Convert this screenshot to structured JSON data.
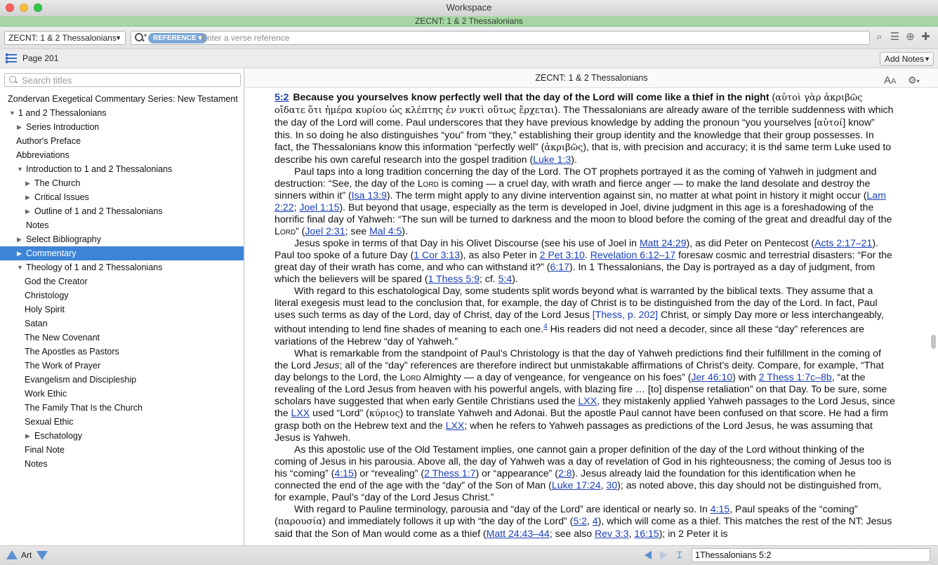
{
  "window": {
    "title": "Workspace",
    "subtitle": "ZECNT: 1 & 2 Thessalonians"
  },
  "toolbar": {
    "book_select": "ZECNT: 1 & 2 Thessalonians",
    "reference_pill": "REFERENCE",
    "reference_placeholder": "Enter a verse reference",
    "icons": [
      "search-icon",
      "list-icon",
      "add-icon",
      "puzzle-icon"
    ]
  },
  "row2": {
    "page_label": "Page 201",
    "add_notes": "Add Notes"
  },
  "sidebar": {
    "search_placeholder": "Search titles",
    "tree": [
      {
        "label": "Zondervan Exegetical Commentary Series: New Testament",
        "level": 0,
        "tri": ""
      },
      {
        "label": "1 and 2 Thessalonians",
        "level": 1,
        "tri": "▼"
      },
      {
        "label": "Series Introduction",
        "level": 2,
        "tri": "▶"
      },
      {
        "label": "Author's Preface",
        "level": 1,
        "tri": ""
      },
      {
        "label": "Abbreviations",
        "level": 1,
        "tri": ""
      },
      {
        "label": "Introduction to 1 and 2 Thessalonians",
        "level": 2,
        "tri": "▼"
      },
      {
        "label": "The Church",
        "level": 3,
        "tri": "▶"
      },
      {
        "label": "Critical Issues",
        "level": 3,
        "tri": "▶"
      },
      {
        "label": "Outline of 1 and 2 Thessalonians",
        "level": 3,
        "tri": "▶"
      },
      {
        "label": "Notes",
        "level": 2,
        "tri": ""
      },
      {
        "label": "Select Bibliography",
        "level": 2,
        "tri": "▶"
      },
      {
        "label": "Commentary",
        "level": 2,
        "tri": "▶",
        "selected": true
      },
      {
        "label": "Theology of 1 and 2 Thessalonians",
        "level": 2,
        "tri": "▼"
      },
      {
        "label": "God the Creator",
        "level": 3,
        "tri": ""
      },
      {
        "label": "Christology",
        "level": 3,
        "tri": ""
      },
      {
        "label": "Holy Spirit",
        "level": 3,
        "tri": ""
      },
      {
        "label": "Satan",
        "level": 3,
        "tri": ""
      },
      {
        "label": "The New Covenant",
        "level": 3,
        "tri": ""
      },
      {
        "label": "The Apostles as Pastors",
        "level": 3,
        "tri": ""
      },
      {
        "label": "The Work of Prayer",
        "level": 3,
        "tri": ""
      },
      {
        "label": "Evangelism and Discipleship",
        "level": 3,
        "tri": ""
      },
      {
        "label": "Work Ethic",
        "level": 3,
        "tri": ""
      },
      {
        "label": "The Family That Is the Church",
        "level": 3,
        "tri": ""
      },
      {
        "label": "Sexual Ethic",
        "level": 3,
        "tri": ""
      },
      {
        "label": "Eschatology",
        "level": 3,
        "tri": "▶"
      },
      {
        "label": "Final Note",
        "level": 3,
        "tri": ""
      },
      {
        "label": "Notes",
        "level": 3,
        "tri": ""
      }
    ]
  },
  "content": {
    "header": "ZECNT: 1 & 2 Thessalonians",
    "aa_icon": "text-size-icon",
    "gear_icon": "gear-icon",
    "paragraphs": [
      [
        {
          "t": "vn",
          "s": "5:2"
        },
        {
          "t": "b",
          "s": "Because you yourselves know perfectly well that the day of the Lord will come like a thief in the night"
        },
        {
          "t": "x",
          "s": " ("
        },
        {
          "t": "g",
          "s": "αὐτοὶ γὰρ ἀκριβῶς οἴδατε ὅτι ἡμέρα κυρίου ὡς κλέπτης ἐν νυκτὶ οὕτως ἔρχεται"
        },
        {
          "t": "x",
          "s": "). The Thessalonians are already aware of the terrible suddenness with which the day of the Lord will come. Paul underscores that they have previous knowledge by adding the pronoun “you yourselves ["
        },
        {
          "t": "g",
          "s": "αὐτοί"
        },
        {
          "t": "x",
          "s": "] know” this. In so doing he also distinguishes “you” from “they,” establishing their group identity and the knowledge that their group possesses. In fact, the Thessalonians know this information “perfectly well” ("
        },
        {
          "t": "g",
          "s": "ἀκριβῶς"
        },
        {
          "t": "x",
          "s": "), that is, with precision and accuracy; it is the same term Luke used to describe his own careful research into the gospel tradition ("
        },
        {
          "t": "l",
          "s": "Luke 1:3"
        },
        {
          "t": "x",
          "s": ")."
        }
      ],
      [
        {
          "t": "x",
          "s": "Paul taps into a long tradition concerning the day of the Lord. The OT prophets portrayed it as the coming of Yahweh in judgment and destruction: “See, the day of the "
        },
        {
          "t": "sc",
          "s": "Lord"
        },
        {
          "t": "x",
          "s": " is coming — a cruel day, with wrath and fierce anger — to make the land desolate and destroy the sinners within it” ("
        },
        {
          "t": "l",
          "s": "Isa 13:9"
        },
        {
          "t": "x",
          "s": "). The term might apply to any divine intervention against sin, no matter at what point in history it might occur ("
        },
        {
          "t": "l",
          "s": "Lam 2:22"
        },
        {
          "t": "x",
          "s": "; "
        },
        {
          "t": "l",
          "s": "Joel 1:15"
        },
        {
          "t": "x",
          "s": "). But beyond that usage, especially as the term is developed in Joel, divine judgment in this age is a foreshadowing of the horrific final day of Yahweh: “The sun will be turned to darkness and the moon to blood before the coming of the great and dreadful day of the "
        },
        {
          "t": "sc",
          "s": "Lord"
        },
        {
          "t": "x",
          "s": "” ("
        },
        {
          "t": "l",
          "s": "Joel 2:31"
        },
        {
          "t": "x",
          "s": "; see "
        },
        {
          "t": "l",
          "s": "Mal 4:5"
        },
        {
          "t": "x",
          "s": ")."
        }
      ],
      [
        {
          "t": "x",
          "s": "Jesus spoke in terms of that Day in his Olivet Discourse (see his use of Joel in "
        },
        {
          "t": "l",
          "s": "Matt 24:29"
        },
        {
          "t": "x",
          "s": "), as did Peter on Pentecost ("
        },
        {
          "t": "l",
          "s": "Acts 2:17–21"
        },
        {
          "t": "x",
          "s": "). Paul too spoke of a future Day ("
        },
        {
          "t": "l",
          "s": "1 Cor 3:13"
        },
        {
          "t": "x",
          "s": "), as also Peter in "
        },
        {
          "t": "l",
          "s": "2 Pet 3:10"
        },
        {
          "t": "x",
          "s": ". "
        },
        {
          "t": "l",
          "s": "Revelation 6:12–17"
        },
        {
          "t": "x",
          "s": " foresaw cosmic and terrestrial disasters: “For the great day of their wrath has come, and who can withstand it?” ("
        },
        {
          "t": "l",
          "s": "6:17"
        },
        {
          "t": "x",
          "s": "). In 1 Thessalonians, the Day is portrayed as a day of judgment, from which the believers will be spared ("
        },
        {
          "t": "l",
          "s": "1 Thess 5:9"
        },
        {
          "t": "x",
          "s": "; cf. "
        },
        {
          "t": "l",
          "s": "5:4"
        },
        {
          "t": "x",
          "s": ")."
        }
      ],
      [
        {
          "t": "x",
          "s": "With regard to this eschatological Day, some students split words beyond what is warranted by the biblical texts. They assume that a literal exegesis must lead to the conclusion that, for example, the day of Christ is to be distinguished from the day of the Lord. In fact, Paul uses such terms as day of the Lord, day of Christ, day of the Lord Jesus "
        },
        {
          "t": "bl",
          "s": "[Thess, p. 202]"
        },
        {
          "t": "x",
          "s": " Christ, or simply Day more or less interchangeably, without intending to lend fine shades of meaning to each one."
        },
        {
          "t": "sup",
          "s": "4"
        },
        {
          "t": "x",
          "s": " His readers did not need a decoder, since all these “day” references are variations of the Hebrew “day of Yahweh.”"
        }
      ],
      [
        {
          "t": "x",
          "s": "What is remarkable from the standpoint of Paul’s Christology is that the day of Yahweh predictions find their fulfillment in the coming of the Lord "
        },
        {
          "t": "i",
          "s": "Jesus"
        },
        {
          "t": "x",
          "s": "; all of the “day” references are therefore indirect but unmistakable affirmations of Christ’s deity. Compare, for example, “That day belongs to the Lord, the "
        },
        {
          "t": "sc",
          "s": "Lord"
        },
        {
          "t": "x",
          "s": " Almighty — a day of vengeance, for vengeance on his foes” ("
        },
        {
          "t": "l",
          "s": "Jer 46:10"
        },
        {
          "t": "x",
          "s": ") with "
        },
        {
          "t": "l",
          "s": "2 Thess 1:7c–8b"
        },
        {
          "t": "x",
          "s": ", “at the revealing of the Lord Jesus from heaven with his powerful angels, with blazing fire … [to] dispense retaliation” on that Day. To be sure, some scholars have suggested that when early Gentile Christians used the "
        },
        {
          "t": "l",
          "s": "LXX"
        },
        {
          "t": "x",
          "s": ", they mistakenly applied Yahweh passages to the Lord Jesus, since the "
        },
        {
          "t": "l",
          "s": "LXX"
        },
        {
          "t": "x",
          "s": " used “Lord” ("
        },
        {
          "t": "g",
          "s": "κύριος"
        },
        {
          "t": "x",
          "s": ") to translate Yahweh and Adonai. But the apostle Paul cannot have been confused on that score. He had a firm grasp both on the Hebrew text and the "
        },
        {
          "t": "l",
          "s": "LXX"
        },
        {
          "t": "x",
          "s": "; when he refers to Yahweh passages as predictions of the Lord Jesus, he was assuming that Jesus is Yahweh."
        }
      ],
      [
        {
          "t": "x",
          "s": "As this apostolic use of the Old Testament implies, one cannot gain a proper definition of the day of the Lord without thinking of the coming of Jesus in his parousia. Above all, the day of Yahweh was a day of revelation of God in his righteousness; the coming of Jesus too is his “coming” ("
        },
        {
          "t": "l",
          "s": "4:15"
        },
        {
          "t": "x",
          "s": ") or “revealing” ("
        },
        {
          "t": "l",
          "s": "2 Thess 1:7"
        },
        {
          "t": "x",
          "s": ") or “appearance” ("
        },
        {
          "t": "l",
          "s": "2:8"
        },
        {
          "t": "x",
          "s": "). Jesus already laid the foundation for this identification when he connected the end of the age with the “day” of the Son of Man ("
        },
        {
          "t": "l",
          "s": "Luke 17:24"
        },
        {
          "t": "x",
          "s": ", "
        },
        {
          "t": "l",
          "s": "30"
        },
        {
          "t": "x",
          "s": "); as noted above, this day should not be distinguished from, for example, Paul’s “day of the Lord Jesus Christ.”"
        }
      ],
      [
        {
          "t": "x",
          "s": "With regard to Pauline terminology, parousia and “day of the Lord” are identical or nearly so. In "
        },
        {
          "t": "l",
          "s": "4:15"
        },
        {
          "t": "x",
          "s": ", Paul speaks of the “coming” ("
        },
        {
          "t": "g",
          "s": "παρουσία"
        },
        {
          "t": "x",
          "s": ") and immediately follows it up with “the day of the Lord” ("
        },
        {
          "t": "l",
          "s": "5:2"
        },
        {
          "t": "x",
          "s": ", "
        },
        {
          "t": "l",
          "s": "4"
        },
        {
          "t": "x",
          "s": "), which will come as a thief. This matches the rest of the NT: Jesus said that the Son of Man would come as a thief ("
        },
        {
          "t": "l",
          "s": "Matt 24:43–44"
        },
        {
          "t": "x",
          "s": "; see also "
        },
        {
          "t": "l",
          "s": "Rev 3:3"
        },
        {
          "t": "x",
          "s": ", "
        },
        {
          "t": "l",
          "s": "16:15"
        },
        {
          "t": "x",
          "s": "); in 2 Peter it is"
        }
      ]
    ]
  },
  "bottom": {
    "art_label": "Art",
    "reference_value": "1Thessalonians 5:2"
  }
}
